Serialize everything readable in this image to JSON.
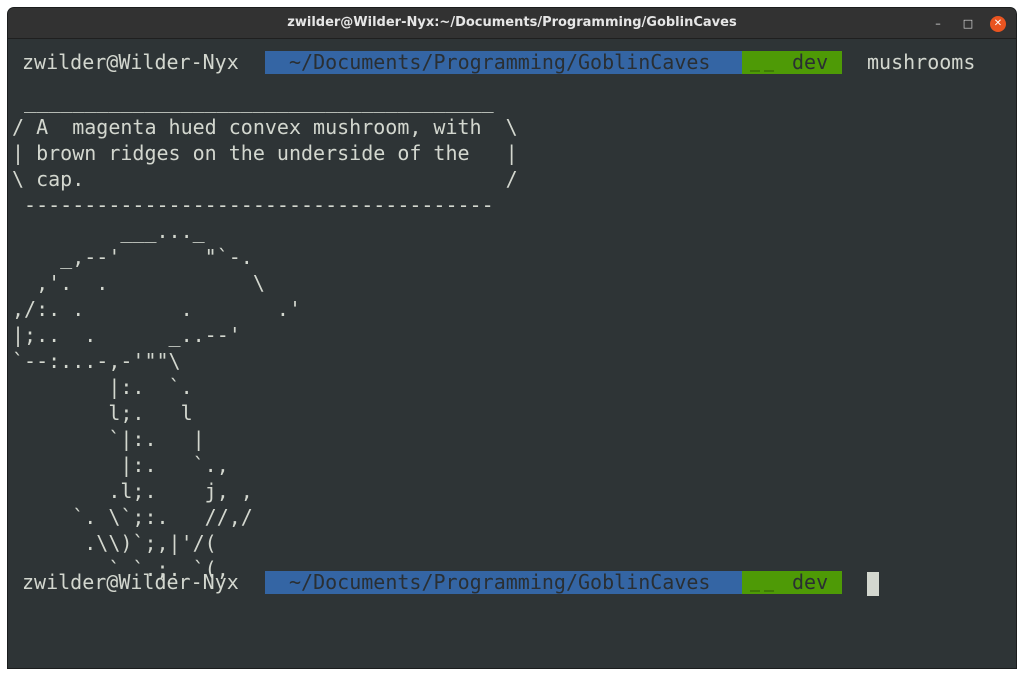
{
  "window": {
    "title": "zwilder@Wilder-Nyx:~/Documents/Programming/GoblinCaves",
    "controls": {
      "minimize": "–",
      "maximize": "□",
      "close": "✕"
    }
  },
  "prompt1": {
    "user_host": "zwilder@Wilder-Nyx",
    "directory": "~/Documents/Programming/GoblinCaves",
    "git_icon": "git-branch-icon",
    "branch": "dev",
    "command": "mushrooms"
  },
  "output_lines": [
    " _______________________________________",
    "/ A  magenta hued convex mushroom, with  \\",
    "| brown ridges on the underside of the   |",
    "\\ cap.                                   /",
    " ---------------------------------------",
    "         ___..._",
    "    _,--'       \"`-.",
    "  ,'.  .            \\",
    ",/:. .        .       .'",
    "|;..  .      _..--'",
    "`--:...-,-'\"\"\\",
    "        |:.  `.",
    "        l;.   l",
    "        `|:.   |",
    "         |:.   `.,",
    "        .l;.    j, ,",
    "     `. \\`;:.   //,/",
    "      .\\\\)`;,|'/(",
    "        ` `.;. `(,"
  ],
  "prompt2": {
    "user_host": "zwilder@Wilder-Nyx",
    "directory": "~/Documents/Programming/GoblinCaves",
    "git_icon": "git-branch-icon",
    "branch": "dev"
  },
  "colors": {
    "terminal_bg": "#2e3436",
    "text": "#d3d7cf",
    "dir_segment": "#3465a4",
    "git_segment": "#4e9a06",
    "close_button": "#e95420"
  }
}
